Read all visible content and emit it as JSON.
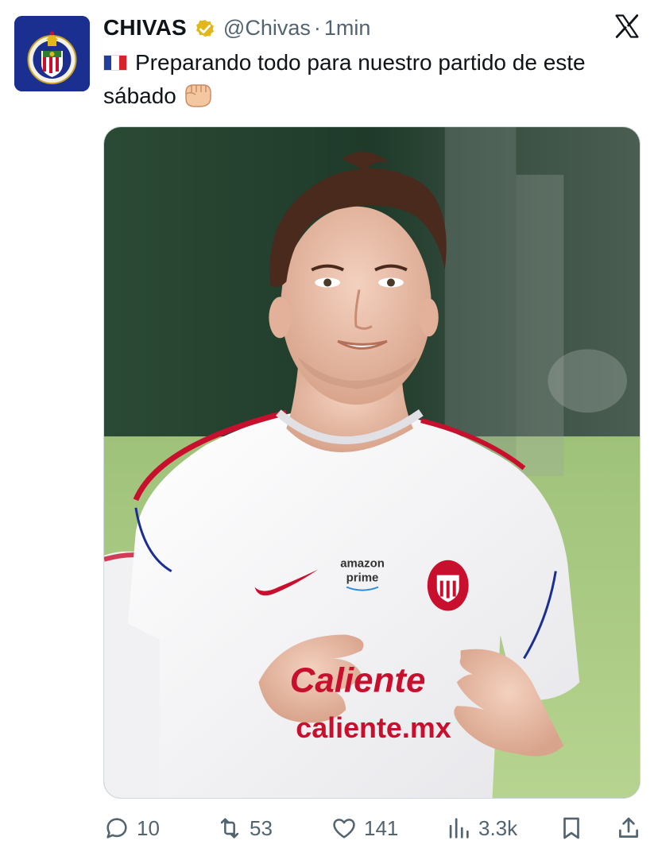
{
  "author": {
    "display_name": "CHIVAS",
    "handle": "@Chivas",
    "separator": "·",
    "time": "1min",
    "verified": true,
    "avatar_icon": "chivas-crest-icon",
    "avatar_bg": "#1a2f8f"
  },
  "platform_icon": "x-logo-icon",
  "tweet": {
    "flag_icon": "france-flag-icon",
    "text": "Preparando todo para nuestro partido de este sábado",
    "trailing_emoji": "fist-emoji-icon"
  },
  "media": {
    "jersey_sponsor_top": "amazon",
    "jersey_sponsor_bottom": "prime",
    "jersey_front": "Caliente",
    "jersey_url": "caliente.mx"
  },
  "actions": {
    "replies": "10",
    "reposts": "53",
    "likes": "141",
    "views": "3.3k"
  },
  "colors": {
    "text_primary": "#0f1419",
    "text_secondary": "#536471",
    "verified_gold": "#e2b719",
    "jersey_red": "#c8102e"
  }
}
